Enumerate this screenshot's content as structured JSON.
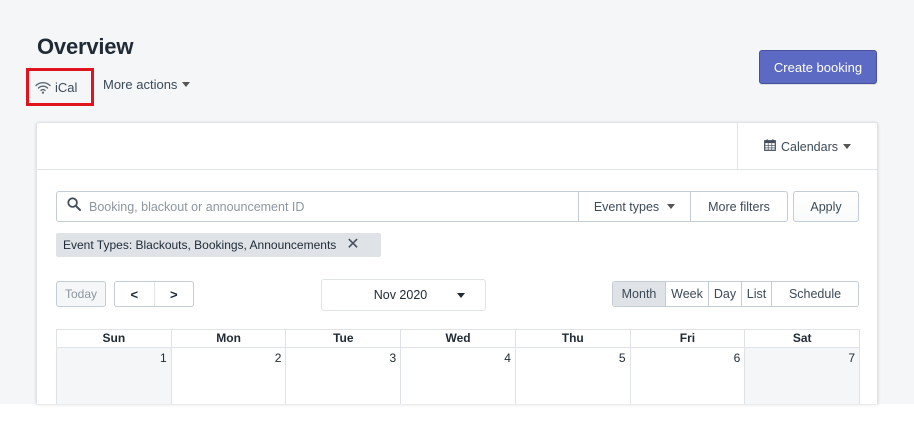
{
  "page": {
    "title": "Overview"
  },
  "actions": {
    "ical_label": "iCal",
    "more_actions_label": "More actions",
    "create_booking_label": "Create booking"
  },
  "card": {
    "calendars_label": "Calendars"
  },
  "search": {
    "placeholder": "Booking, blackout or announcement ID",
    "value": ""
  },
  "filters": {
    "event_types_label": "Event types",
    "more_filters_label": "More filters",
    "apply_label": "Apply",
    "active_tag": "Event Types: Blackouts, Bookings, Announcements",
    "tag_remove_glyph": "✕"
  },
  "calendar_nav": {
    "today_label": "Today",
    "prev_glyph": "<",
    "next_glyph": ">",
    "selected_month": "Nov 2020"
  },
  "views": {
    "items": [
      "Month",
      "Week",
      "Day",
      "List",
      "Schedule"
    ],
    "active": "Month"
  },
  "calendar": {
    "weekdays": [
      "Sun",
      "Mon",
      "Tue",
      "Wed",
      "Thu",
      "Fri",
      "Sat"
    ],
    "first_week": [
      "1",
      "2",
      "3",
      "4",
      "5",
      "6",
      "7"
    ]
  },
  "colors": {
    "primary": "#5c6ac4",
    "highlight_border": "#e0141e",
    "page_bg": "#f4f6f8",
    "weekend_bg": "#f4f6f8"
  },
  "icons": {
    "ical": "wifi-icon",
    "calendars": "calendar-icon",
    "search": "search-icon"
  }
}
